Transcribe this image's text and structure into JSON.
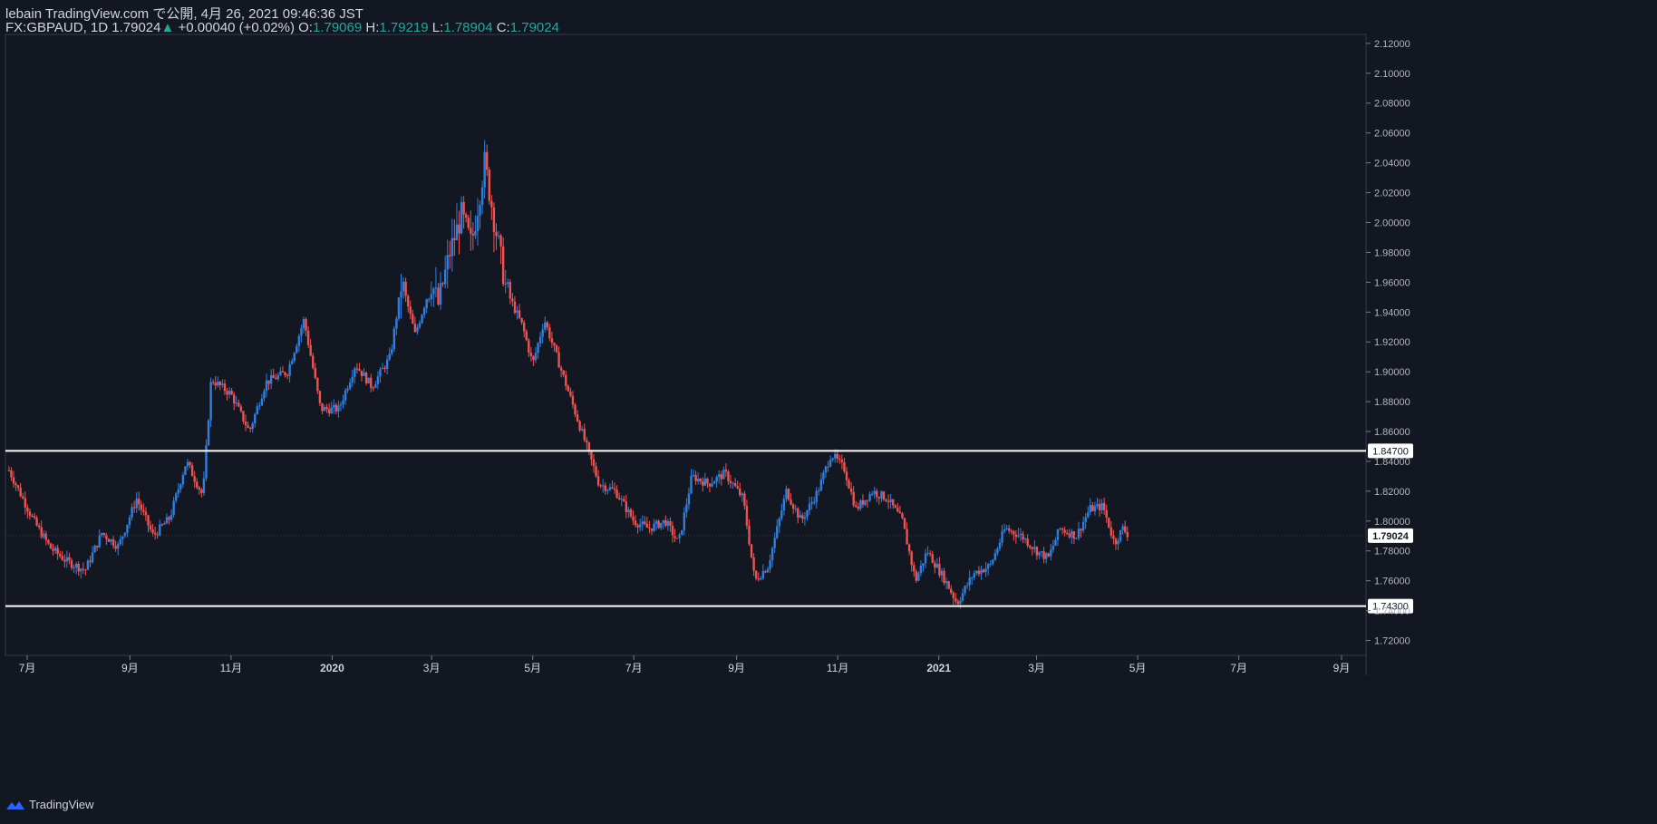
{
  "header": {
    "publisher": "lebain TradingView.com で公開, 4月 26, 2021 09:46:36 JST",
    "symbol": "FX:GBPAUD, 1D",
    "last": "1.79024",
    "change": "+0.00040 (+0.02%)",
    "o_label": "O:",
    "o": "1.79069",
    "h_label": "H:",
    "h": "1.79219",
    "l_label": "L:",
    "l": "1.78904",
    "c_label": "C:",
    "c": "1.79024"
  },
  "footer": {
    "brand": "TradingView"
  },
  "colors": {
    "background": "#131722",
    "up": "#2f7fe0",
    "down": "#ef5350",
    "level_line": "#ffffff"
  },
  "chart_data": {
    "type": "candlestick",
    "symbol": "FX:GBPAUD",
    "timeframe": "1D",
    "ylim": [
      1.71,
      2.126
    ],
    "y_ticks": [
      "2.12000",
      "2.10000",
      "2.08000",
      "2.06000",
      "2.04000",
      "2.02000",
      "2.00000",
      "1.98000",
      "1.96000",
      "1.94000",
      "1.92000",
      "1.90000",
      "1.88000",
      "1.86000",
      "1.84000",
      "1.82000",
      "1.80000",
      "1.78000",
      "1.76000",
      "1.74000",
      "1.72000"
    ],
    "x_ticks": [
      "7月",
      "9月",
      "11月",
      "2020",
      "3月",
      "5月",
      "7月",
      "9月",
      "11月",
      "2021",
      "3月",
      "5月",
      "7月",
      "9月"
    ],
    "x_tick_dates": [
      "2019-07",
      "2019-09",
      "2019-11",
      "2020-01",
      "2020-03",
      "2020-05",
      "2020-07",
      "2020-09",
      "2020-11",
      "2021-01",
      "2021-03",
      "2021-05",
      "2021-07",
      "2021-09"
    ],
    "horizontal_levels": [
      {
        "value": 1.847,
        "label": "1.84700"
      },
      {
        "value": 1.743,
        "label": "1.74300"
      }
    ],
    "last_price": {
      "value": 1.79024,
      "label": "1.79024"
    },
    "approx_close_path": [
      [
        "2019-06-20",
        1.834
      ],
      [
        "2019-07-05",
        1.8
      ],
      [
        "2019-07-15",
        1.782
      ],
      [
        "2019-07-25",
        1.773
      ],
      [
        "2019-08-05",
        1.767
      ],
      [
        "2019-08-15",
        1.792
      ],
      [
        "2019-08-25",
        1.783
      ],
      [
        "2019-09-05",
        1.815
      ],
      [
        "2019-09-15",
        1.79
      ],
      [
        "2019-09-25",
        1.802
      ],
      [
        "2019-10-05",
        1.84
      ],
      [
        "2019-10-15",
        1.817
      ],
      [
        "2019-10-20",
        1.895
      ],
      [
        "2019-11-01",
        1.885
      ],
      [
        "2019-11-12",
        1.86
      ],
      [
        "2019-11-22",
        1.893
      ],
      [
        "2019-12-05",
        1.9
      ],
      [
        "2019-12-15",
        1.935
      ],
      [
        "2019-12-25",
        1.875
      ],
      [
        "2020-01-05",
        1.875
      ],
      [
        "2020-01-15",
        1.905
      ],
      [
        "2020-01-25",
        1.89
      ],
      [
        "2020-02-05",
        1.91
      ],
      [
        "2020-02-12",
        1.96
      ],
      [
        "2020-02-20",
        1.925
      ],
      [
        "2020-03-01",
        1.96
      ],
      [
        "2020-03-05",
        1.945
      ],
      [
        "2020-03-12",
        1.98
      ],
      [
        "2020-03-19",
        2.005
      ],
      [
        "2020-03-25",
        1.985
      ],
      [
        "2020-04-02",
        2.04
      ],
      [
        "2020-04-08",
        2.0
      ],
      [
        "2020-04-15",
        1.955
      ],
      [
        "2020-04-25",
        1.93
      ],
      [
        "2020-05-01",
        1.905
      ],
      [
        "2020-05-08",
        1.935
      ],
      [
        "2020-05-20",
        1.895
      ],
      [
        "2020-06-01",
        1.855
      ],
      [
        "2020-06-10",
        1.825
      ],
      [
        "2020-06-20",
        1.82
      ],
      [
        "2020-07-01",
        1.8
      ],
      [
        "2020-07-10",
        1.795
      ],
      [
        "2020-07-20",
        1.8
      ],
      [
        "2020-07-28",
        1.785
      ],
      [
        "2020-08-05",
        1.83
      ],
      [
        "2020-08-15",
        1.825
      ],
      [
        "2020-08-25",
        1.832
      ],
      [
        "2020-09-05",
        1.815
      ],
      [
        "2020-09-12",
        1.76
      ],
      [
        "2020-09-20",
        1.77
      ],
      [
        "2020-10-01",
        1.82
      ],
      [
        "2020-10-10",
        1.8
      ],
      [
        "2020-10-20",
        1.82
      ],
      [
        "2020-10-28",
        1.845
      ],
      [
        "2020-11-05",
        1.835
      ],
      [
        "2020-11-12",
        1.808
      ],
      [
        "2020-11-22",
        1.82
      ],
      [
        "2020-12-01",
        1.815
      ],
      [
        "2020-12-10",
        1.8
      ],
      [
        "2020-12-18",
        1.76
      ],
      [
        "2020-12-25",
        1.78
      ],
      [
        "2021-01-05",
        1.76
      ],
      [
        "2021-01-12",
        1.745
      ],
      [
        "2021-01-22",
        1.765
      ],
      [
        "2021-02-01",
        1.77
      ],
      [
        "2021-02-10",
        1.795
      ],
      [
        "2021-02-20",
        1.79
      ],
      [
        "2021-03-01",
        1.78
      ],
      [
        "2021-03-08",
        1.775
      ],
      [
        "2021-03-15",
        1.795
      ],
      [
        "2021-03-25",
        1.79
      ],
      [
        "2021-04-02",
        1.808
      ],
      [
        "2021-04-10",
        1.81
      ],
      [
        "2021-04-17",
        1.785
      ],
      [
        "2021-04-22",
        1.795
      ],
      [
        "2021-04-26",
        1.79
      ]
    ],
    "grid": false,
    "legend": "top-left"
  }
}
